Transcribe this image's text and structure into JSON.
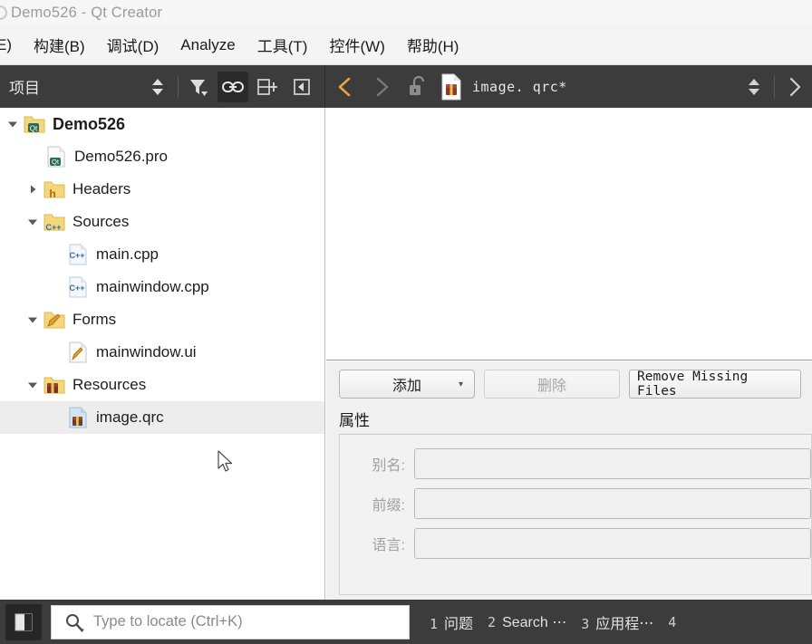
{
  "window": {
    "title": "Demo526 - Qt Creator",
    "app_icon": "qt-logo-icon"
  },
  "menubar": {
    "items": [
      {
        "label": "E)",
        "accel": ""
      },
      {
        "label": "构建(B)",
        "accel": "B"
      },
      {
        "label": "调试(D)",
        "accel": "D"
      },
      {
        "label": "Analyze",
        "accel": "A"
      },
      {
        "label": "工具(T)",
        "accel": "T"
      },
      {
        "label": "控件(W)",
        "accel": "W"
      },
      {
        "label": "帮助(H)",
        "accel": "H"
      }
    ]
  },
  "sidebar_toolbar": {
    "title": "项目",
    "buttons": [
      {
        "name": "sync-selection-button",
        "icon": "up-down-arrows-icon",
        "active": false
      },
      {
        "name": "filter-button",
        "icon": "filter-funnel-icon",
        "active": false
      },
      {
        "name": "link-with-editor-button",
        "icon": "link-icon",
        "active": true
      },
      {
        "name": "split-button",
        "icon": "split-add-icon",
        "active": false
      },
      {
        "name": "close-sidebar-button",
        "icon": "collapse-left-icon",
        "active": false
      }
    ]
  },
  "editor_toolbar": {
    "back_enabled": true,
    "forward_enabled": false,
    "lock_state": "unlocked",
    "document_icon": "qrc-file-icon",
    "document_name": "image. qrc*",
    "split_icon": "up-down-arrows-icon",
    "more_icon": "chevron-right-icon"
  },
  "project_tree": {
    "items": [
      {
        "label": "Demo526",
        "icon": "qt-project-folder-icon",
        "arrow": "down",
        "indent": 0,
        "bold": true,
        "selected": false
      },
      {
        "label": "Demo526.pro",
        "icon": "qt-pro-file-icon",
        "arrow": "none",
        "indent": 1,
        "bold": false,
        "selected": false
      },
      {
        "label": "Headers",
        "icon": "folder-h-icon",
        "arrow": "right",
        "indent": 1,
        "bold": false,
        "selected": false
      },
      {
        "label": "Sources",
        "icon": "folder-cpp-icon",
        "arrow": "down",
        "indent": 1,
        "bold": false,
        "selected": false
      },
      {
        "label": "main.cpp",
        "icon": "cpp-file-icon",
        "arrow": "none",
        "indent": 2,
        "bold": false,
        "selected": false
      },
      {
        "label": "mainwindow.cpp",
        "icon": "cpp-file-icon",
        "arrow": "none",
        "indent": 2,
        "bold": false,
        "selected": false
      },
      {
        "label": "Forms",
        "icon": "folder-form-icon",
        "arrow": "down",
        "indent": 1,
        "bold": false,
        "selected": false
      },
      {
        "label": "mainwindow.ui",
        "icon": "ui-file-icon",
        "arrow": "none",
        "indent": 2,
        "bold": false,
        "selected": false
      },
      {
        "label": "Resources",
        "icon": "folder-resource-icon",
        "arrow": "down",
        "indent": 1,
        "bold": false,
        "selected": false
      },
      {
        "label": "image.qrc",
        "icon": "qrc-file-icon",
        "arrow": "none",
        "indent": 2,
        "bold": false,
        "selected": true
      }
    ]
  },
  "qrc_editor": {
    "add_button": "添加",
    "add_caret": "▾",
    "remove_button": "删除",
    "remove_missing_button": "Remove Missing Files",
    "properties_title": "属性",
    "properties": [
      {
        "label": "别名:",
        "value": "",
        "placeholder": "",
        "enabled": false
      },
      {
        "label": "前缀:",
        "value": "",
        "placeholder": "",
        "enabled": false
      },
      {
        "label": "语言:",
        "value": "",
        "placeholder": "",
        "enabled": false
      }
    ]
  },
  "statusbar": {
    "sidebar_toggle_icon": "sidebar-toggle-icon",
    "locator": {
      "icon": "search-icon",
      "value": "",
      "placeholder": "Type to locate (Ctrl+K)"
    },
    "tabs": [
      {
        "number": "1",
        "label": "问题"
      },
      {
        "number": "2",
        "label": "Search ⋯"
      },
      {
        "number": "3",
        "label": "应用程⋯"
      },
      {
        "number": "4",
        "label": ""
      }
    ]
  },
  "colors": {
    "toolbar_bg": "#3c3c3c",
    "titlebar_bg": "#f6f6f6",
    "menubar_bg": "#f4f4f4",
    "panel_bg": "#f0f0f0",
    "selection": "#ededed",
    "accent_back_arrow": "#e8a33d",
    "folder_yellow": "#f5d67a"
  }
}
